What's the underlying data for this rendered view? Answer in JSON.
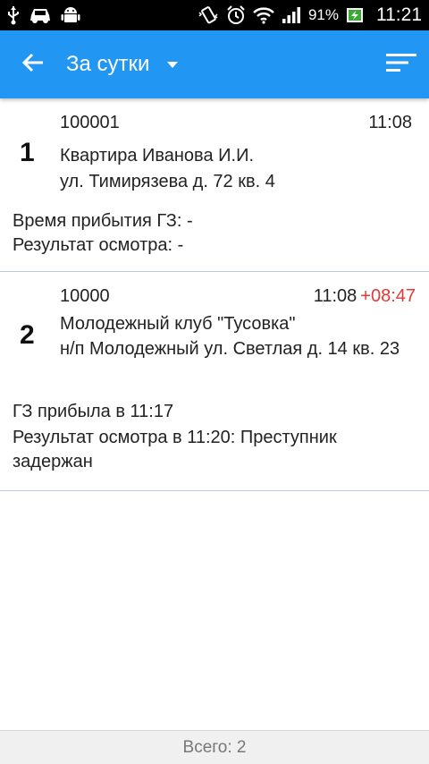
{
  "status_bar": {
    "battery": "91%",
    "time": "11:21"
  },
  "app_bar": {
    "title": "За сутки"
  },
  "items": [
    {
      "index": "1",
      "id": "100001",
      "time": "11:08",
      "delay": "",
      "name": "Квартира Иванова И.И.",
      "address": "ул. Тимирязева д. 72 кв. 4",
      "arrival": "Время прибытия ГЗ: -",
      "result": "Результат осмотра: -"
    },
    {
      "index": "2",
      "id": "10000",
      "time": "11:08",
      "delay": "+08:47",
      "name": "Молодежный клуб \"Тусовка\"",
      "address": "н/п Молодежный ул. Светлая д. 14 кв. 23",
      "arrival": "ГЗ прибыла в 11:17",
      "result": "Результат осмотра в 11:20: Преступник задержан"
    }
  ],
  "footer": {
    "total": "Всего: 2"
  },
  "colors": {
    "app_bar": "#2196F3",
    "delay": "#e53935",
    "divider": "#b8cde0"
  }
}
